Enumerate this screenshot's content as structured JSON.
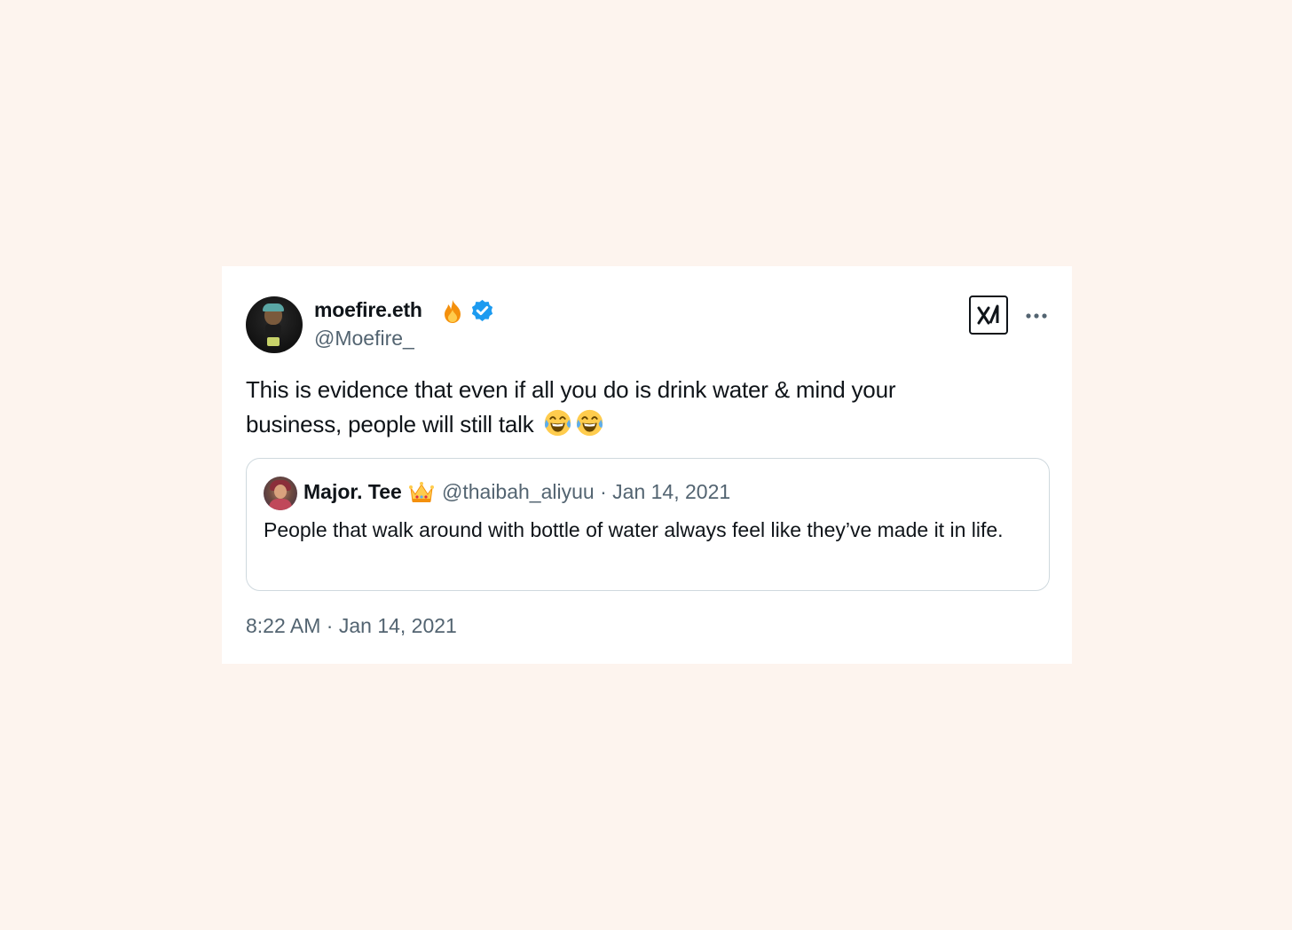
{
  "tweet": {
    "display_name": "moefire.eth",
    "handle": "@Moefire_",
    "text": "This is evidence that even if all you do is drink water & mind your business, people will still talk",
    "emoji_icons": [
      "face-with-tears-of-joy-icon",
      "face-with-tears-of-joy-icon"
    ],
    "badge_icons": [
      "fire-icon",
      "verified-badge-icon"
    ],
    "time": "8:22 AM",
    "separator": "·",
    "date": "Jan 14, 2021"
  },
  "quoted_tweet": {
    "display_name": "Major. Tee",
    "badge_icon": "crown-icon",
    "handle": "@thaibah_aliyuu",
    "separator": "·",
    "date": "Jan 14, 2021",
    "text": "People that walk around with bottle of water always feel like they’ve made it in life."
  },
  "actions": {
    "logo_icon": "x-logo-icon",
    "more_icon": "more-options-icon"
  },
  "colors": {
    "page_background": "#fdf4ee",
    "card_background": "#ffffff",
    "text_primary": "#0f1419",
    "text_secondary": "#536471",
    "verified_blue": "#1d9bf0",
    "border": "#cfd9de"
  }
}
